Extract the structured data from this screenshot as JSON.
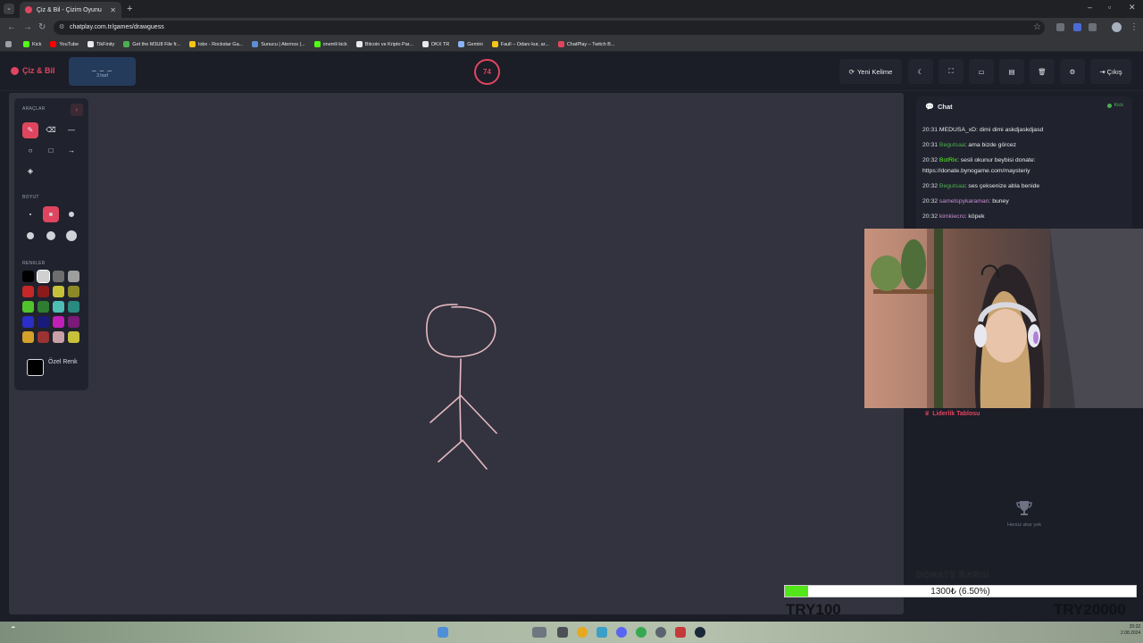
{
  "browser": {
    "tab_title": "Çiz & Bil - Çizim Oyunu",
    "url": "chatplay.com.tr/games/drawguess",
    "bookmarks": [
      {
        "label": "Kick",
        "color": "#53fc18"
      },
      {
        "label": "YouTube",
        "color": "#ff0000"
      },
      {
        "label": "TikFinity",
        "color": "#e8eaed"
      },
      {
        "label": "Get the M3U8 File fr...",
        "color": "#4caf50"
      },
      {
        "label": "lobx - Rockstar Ga...",
        "color": "#f5c518"
      },
      {
        "label": "Sunucu | Aternos |...",
        "color": "#5c8fd6"
      },
      {
        "label": "onemli kick",
        "color": "#53fc18"
      },
      {
        "label": "Bitcoin ve Kripto Par...",
        "color": "#e8eaed"
      },
      {
        "label": "OKX TR",
        "color": "#e8eaed"
      },
      {
        "label": "Gemini",
        "color": "#8ab4f8"
      },
      {
        "label": "Faull – Odanı kur, ar...",
        "color": "#f5c518"
      },
      {
        "label": "ChatPlay – Twitch B...",
        "color": "#e0455f"
      }
    ]
  },
  "header": {
    "logo": "Çiz & Bil",
    "word_hint": "_ _ _",
    "letter_count": "3 harf",
    "timer": "74",
    "new_word": "Yeni Kelime",
    "exit": "Çıkış"
  },
  "tools": {
    "tools_label": "ARAÇLAR",
    "size_label": "BOYUT",
    "colors_label": "RENKLER",
    "custom_color_label": "Özel Renk",
    "colors": [
      "#000000",
      "#d0d0d0",
      "#6e6e6e",
      "#9e9e9e",
      "#c62828",
      "#8b1a1a",
      "#c6c23a",
      "#8c8a26",
      "#52c42b",
      "#2e7d32",
      "#4dbfb5",
      "#2a8a80",
      "#2c2ec8",
      "#1a1a7a",
      "#c21fb8",
      "#7b1a78",
      "#d4a129",
      "#9c3232",
      "#c9a0a6",
      "#c8c03a"
    ]
  },
  "chat": {
    "title": "Chat",
    "status": "Kick",
    "messages": [
      {
        "time": "20:31",
        "user": "MEDUSA_xD",
        "text": "dimi dimi askdjaskdjasd",
        "color": "#e8eaed"
      },
      {
        "time": "20:31",
        "user": "Begutsaa",
        "text": "ama bizde görcez",
        "color": "#4caf50"
      },
      {
        "time": "20:32",
        "user": "BotRix",
        "text": "sesli okunur beybisi donate: https://donate.bynogame.com/maysteriy",
        "color": "#53fc18"
      },
      {
        "time": "20:32",
        "user": "Begutsaa",
        "text": "ses çeksenize abla benide",
        "color": "#4caf50"
      },
      {
        "time": "20:32",
        "user": "sametspykaraman",
        "text": "buney",
        "color": "#c98cd6"
      },
      {
        "time": "20:32",
        "user": "kimkiecro",
        "text": "köpek",
        "color": "#c98cd6"
      }
    ]
  },
  "leaderboard": {
    "title": "Liderlik Tablosu",
    "empty": "Henüz skor yok"
  },
  "donate": {
    "title": "DONATE BARI!!",
    "progress_text": "1300₺ (6.50%)",
    "progress_percent": 6.5,
    "min": "TRY100",
    "max": "TRY20000"
  },
  "taskbar": {
    "clock_time": "20:32",
    "clock_date": "2.08.2024"
  }
}
